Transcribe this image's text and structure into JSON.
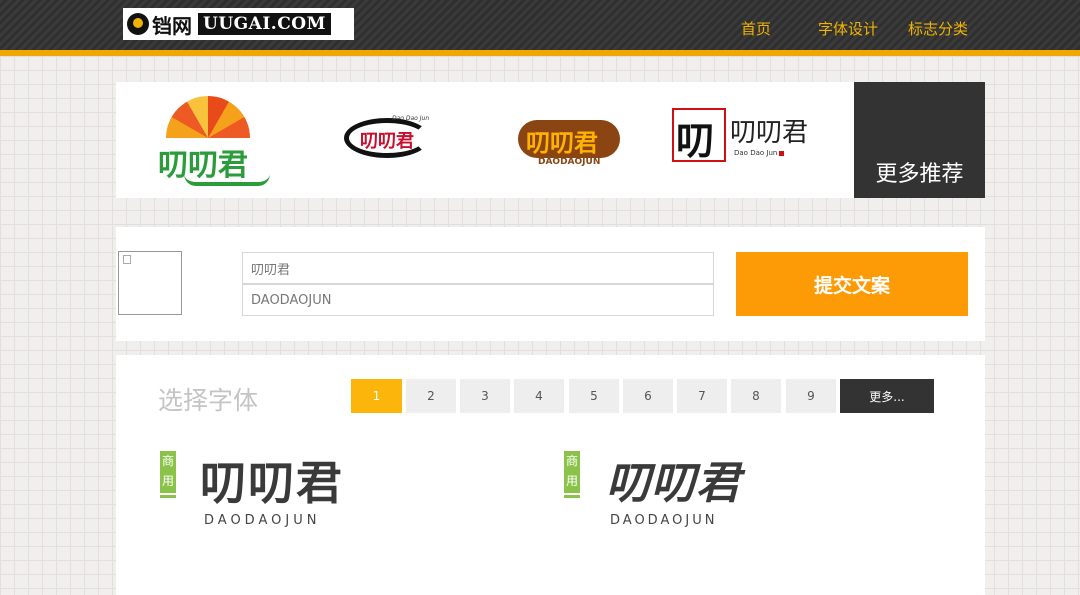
{
  "header": {
    "logo_cn": "铛网",
    "logo_en": "UUGAI.COM",
    "nav": [
      "首页",
      "字体设计",
      "标志分类"
    ]
  },
  "recommend": {
    "more_label": "更多推荐",
    "items": [
      {
        "cn": "叨叨君",
        "en": ""
      },
      {
        "cn": "叨叨君",
        "en": "Dao Dao Jun"
      },
      {
        "cn": "叨叨君",
        "en": "DAODAOJUN"
      },
      {
        "cn": "叨叨君",
        "en": "Dao Dao Jun"
      }
    ]
  },
  "form": {
    "name_value": "叨叨君",
    "pinyin_value": "DAODAOJUN",
    "submit_label": "提交文案"
  },
  "fonts": {
    "title": "选择字体",
    "pages": [
      "1",
      "2",
      "3",
      "4",
      "5",
      "6",
      "7",
      "8",
      "9"
    ],
    "active_page": "1",
    "more_label": "更多...",
    "samples": [
      {
        "badge": "商用",
        "cn": "叨叨君",
        "en": "DAODAOJUN"
      },
      {
        "badge": "商用",
        "cn": "叨叨君",
        "en": "DAODAOJUN"
      }
    ]
  },
  "colors": {
    "accent": "#fc9b06",
    "page_active": "#fcb50b",
    "badge": "#8bc34a",
    "nav_text": "#f0b400"
  }
}
